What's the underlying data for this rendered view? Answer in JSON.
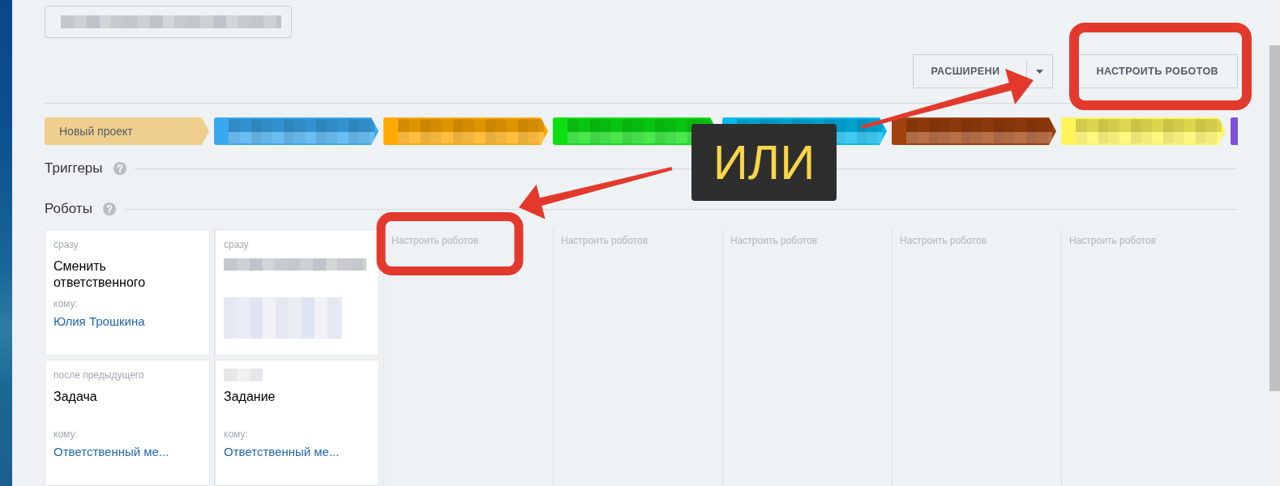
{
  "title_field": {
    "redacted": true
  },
  "toolbar": {
    "buttons": [
      {
        "kind": "split",
        "label": "РАСШИРЕНИ"
      },
      {
        "kind": "plain",
        "label": "НАСТРОИТЬ РОБОТОВ"
      }
    ]
  },
  "stages": [
    {
      "label": "Новый проект",
      "color": "#efcf8e",
      "redacted": false
    },
    {
      "color": "#3aa8ee",
      "redacted": true
    },
    {
      "color": "#ffa900",
      "redacted": true
    },
    {
      "color": "#0ce013",
      "redacted": true
    },
    {
      "color": "#00b9ee",
      "redacted": true
    },
    {
      "color": "#a0410e",
      "redacted": true
    },
    {
      "color": "#fff55a",
      "redacted": true
    },
    {
      "color": "#7b52d3",
      "redacted": false
    }
  ],
  "triggers": {
    "title": "Триггеры"
  },
  "robots": {
    "title": "Роботы",
    "columns": [
      {
        "cards": [
          {
            "delay": "сразу",
            "title": "Сменить ответственного",
            "to_label": "кому:",
            "assignee": "Юлия Трошкина"
          },
          {
            "delay": "после предыдущего",
            "title": "Задача",
            "to_label": "кому:",
            "assignee": "Ответственный ме..."
          }
        ]
      },
      {
        "cards": [
          {
            "delay": "сразу"
          },
          {
            "title": "Задание",
            "to_label": "кому:",
            "assignee": "Ответственный ме..."
          }
        ]
      },
      {
        "setup_link": "Настроить роботов"
      },
      {
        "setup_link": "Настроить роботов"
      },
      {
        "setup_link": "Настроить роботов"
      },
      {
        "setup_link": "Настроить роботов"
      },
      {
        "setup_link": "Настроить роботов"
      }
    ]
  },
  "callout": {
    "text": "ИЛИ"
  }
}
